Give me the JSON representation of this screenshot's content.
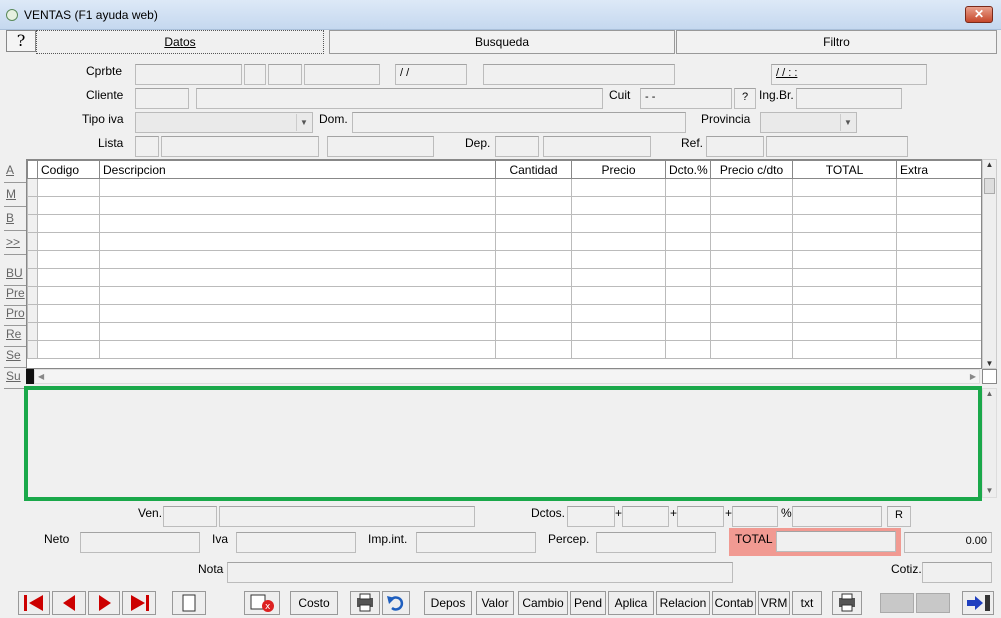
{
  "window": {
    "title": "VENTAS (F1 ayuda web)",
    "close": "✕"
  },
  "tabs": {
    "help": "?",
    "datos": "Datos",
    "busqueda": "Busqueda",
    "filtro": "Filtro"
  },
  "header": {
    "cprbte_label": "Cprbte",
    "cprbte_date": "/ /",
    "datetime": "/ /     :  :",
    "cliente_label": "Cliente",
    "cuit_label": "Cuit",
    "cuit_value": "-       -",
    "cuit_btn": "?",
    "ingbr_label": "Ing.Br.",
    "tipo_iva_label": "Tipo iva",
    "dom_label": "Dom.",
    "provincia_label": "Provincia",
    "lista_label": "Lista",
    "dep_label": "Dep.",
    "ref_label": "Ref."
  },
  "side_buttons": [
    "A",
    "M",
    "B",
    ">>",
    "BU",
    "Pre",
    "Pro",
    "Re",
    "Se",
    "Su"
  ],
  "grid": {
    "columns": [
      "Codigo",
      "Descripcion",
      "Cantidad",
      "Precio",
      "Dcto.%",
      "Precio c/dto",
      "TOTAL",
      "Extra"
    ]
  },
  "footer": {
    "ven_label": "Ven.",
    "dctos_label": "Dctos.",
    "plus": "+",
    "pct": "%",
    "r_btn": "R",
    "neto_label": "Neto",
    "iva_label": "Iva",
    "impint_label": "Imp.int.",
    "percep_label": "Percep.",
    "total_label": "TOTAL",
    "total_value": "0.00",
    "nota_label": "Nota",
    "cotiz_label": "Cotiz."
  },
  "toolbar": {
    "costo": "Costo",
    "depos": "Depos",
    "valor": "Valor",
    "cambio": "Cambio",
    "pend": "Pend",
    "aplica": "Aplica",
    "relacion": "Relacion",
    "contab": "Contab",
    "vrm": "VRM",
    "txt": "txt"
  },
  "colors": {
    "total_highlight": "#f19a92",
    "green_frame": "#1aa84a"
  }
}
